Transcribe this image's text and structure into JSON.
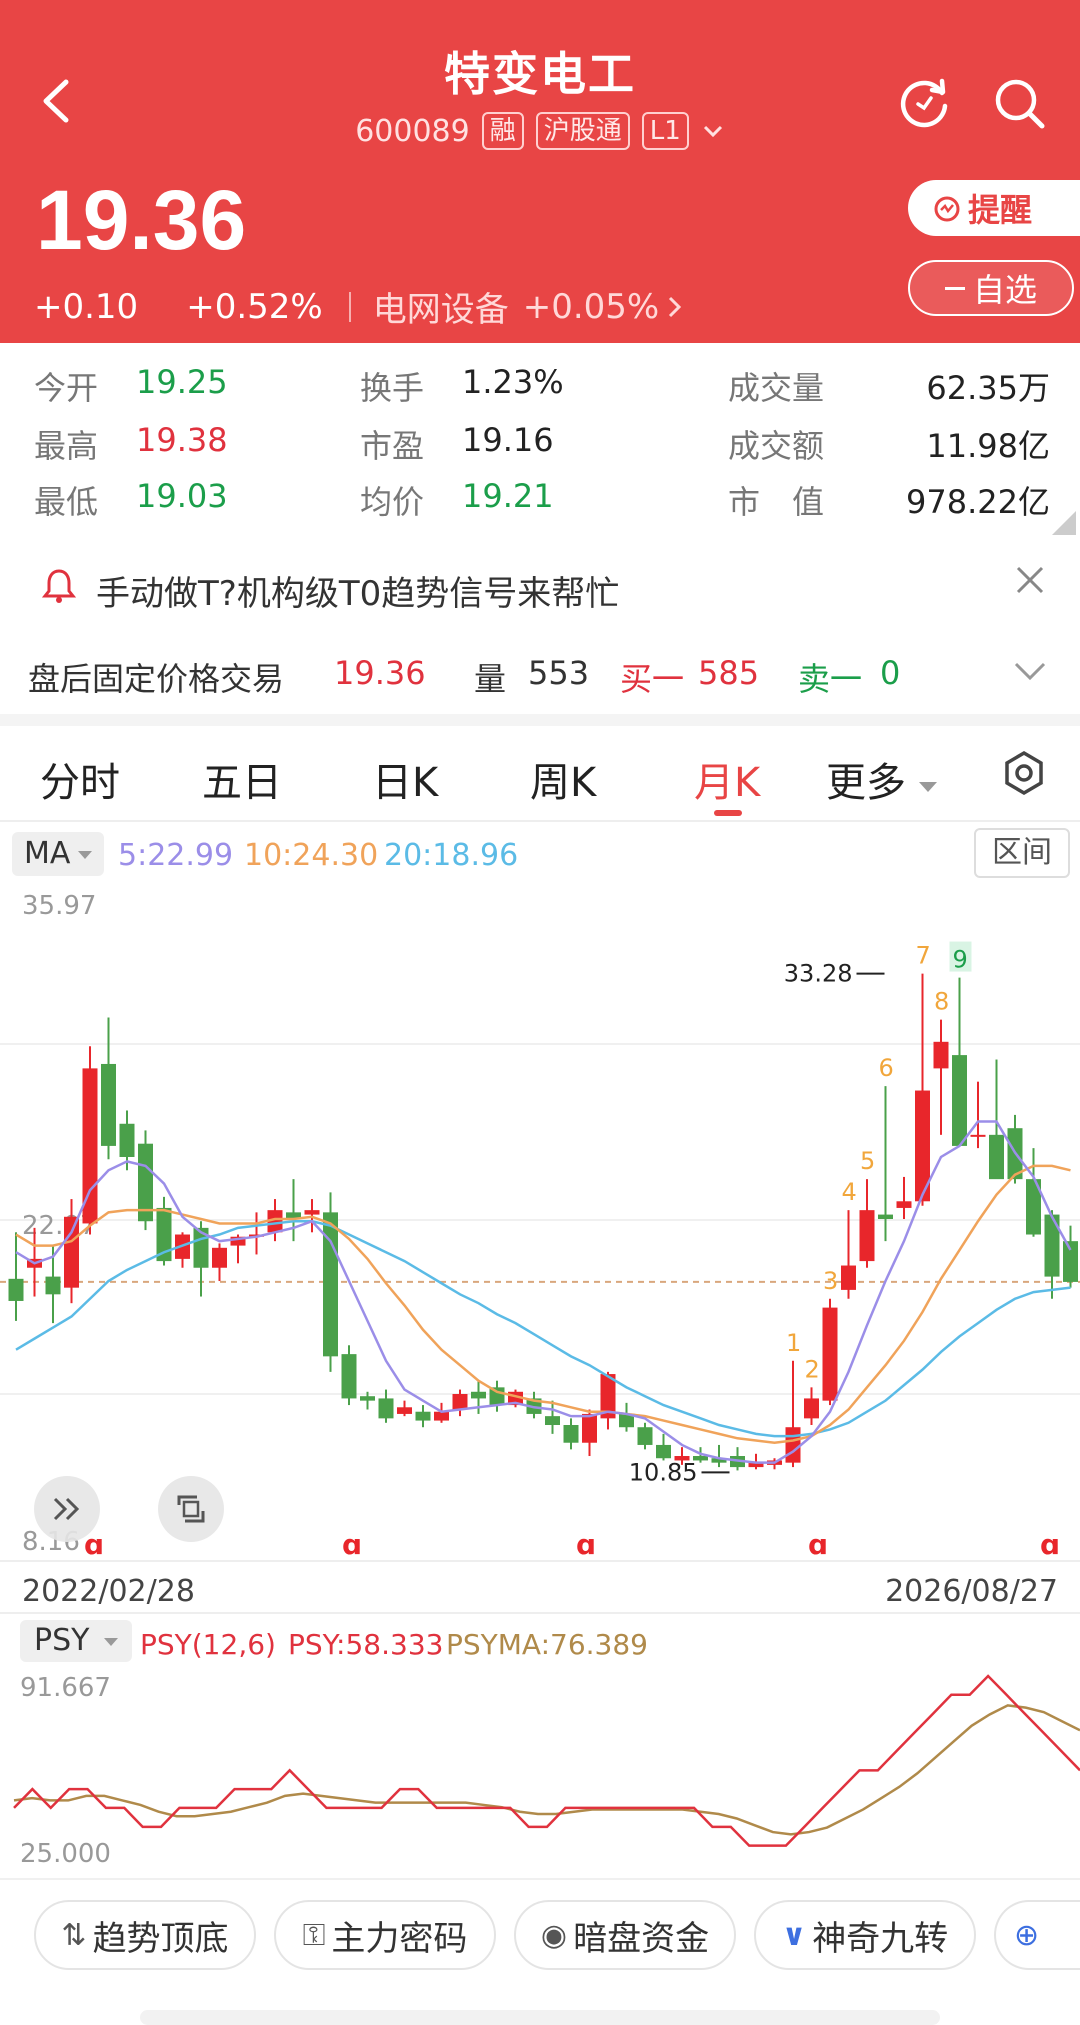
{
  "header": {
    "stock_name": "特变电工",
    "code": "600089",
    "tag_margin": "融",
    "tag_connect": "沪股通",
    "tag_level": "L1",
    "price": "19.36",
    "change": "+0.10",
    "change_pct": "+0.52%",
    "sector": "电网设备",
    "sector_pct": "+0.05%",
    "remind_label": "提醒",
    "watch_label": "自选",
    "colors": {
      "bg": "#e84545"
    }
  },
  "stats": {
    "open_label": "今开",
    "open": "19.25",
    "high_label": "最高",
    "high": "19.38",
    "low_label": "最低",
    "low": "19.03",
    "turnover_label": "换手",
    "turnover": "1.23%",
    "pe_label": "市盈",
    "pe": "19.16",
    "avg_label": "均价",
    "avg": "19.21",
    "volume_label": "成交量",
    "volume": "62.35万",
    "amount_label": "成交额",
    "amount": "11.98亿",
    "mcap_label": "市　值",
    "mcap": "978.22亿"
  },
  "promo": {
    "text": "手动做T?机构级T0趋势信号来帮忙"
  },
  "after_hours": {
    "label": "盘后固定价格交易",
    "price": "19.36",
    "vol_label": "量",
    "vol": "553",
    "bid_label": "买一",
    "bid": "585",
    "ask_label": "卖一",
    "ask": "0"
  },
  "tabs": [
    "分时",
    "五日",
    "日K",
    "周K",
    "月K",
    "更多"
  ],
  "ma": {
    "selector": "MA",
    "ma5": "5:22.99",
    "ma10": "10:24.30",
    "ma20": "20:18.96",
    "range_label": "区间",
    "colors": {
      "ma5": "#9b8ee8",
      "ma10": "#f0a35a",
      "ma20": "#5bbbe6"
    }
  },
  "chart_data": {
    "type": "candlestick",
    "y_top_label": "35.97",
    "y_bottom_label": "8.16",
    "y_mid_label": "22.07",
    "ylim": [
      8.16,
      35.97
    ],
    "current_price_line": 19.36,
    "start_date": "2022/02/28",
    "end_date": "2026/08/27",
    "high_marker": "33.28",
    "low_marker": "10.85",
    "candles": [
      {
        "o": 19.5,
        "h": 21.6,
        "l": 17.6,
        "c": 18.5
      },
      {
        "o": 20.0,
        "h": 21.8,
        "l": 18.7,
        "c": 20.4
      },
      {
        "o": 19.6,
        "h": 21.0,
        "l": 17.5,
        "c": 18.8
      },
      {
        "o": 19.1,
        "h": 23.1,
        "l": 18.4,
        "c": 22.3
      },
      {
        "o": 22.0,
        "h": 30.0,
        "l": 21.5,
        "c": 29.0
      },
      {
        "o": 29.2,
        "h": 31.3,
        "l": 24.9,
        "c": 25.5
      },
      {
        "o": 26.5,
        "h": 27.1,
        "l": 24.4,
        "c": 25.0
      },
      {
        "o": 25.6,
        "h": 26.2,
        "l": 21.7,
        "c": 22.1
      },
      {
        "o": 22.7,
        "h": 23.2,
        "l": 20.1,
        "c": 20.3
      },
      {
        "o": 20.4,
        "h": 21.6,
        "l": 20.0,
        "c": 21.5
      },
      {
        "o": 21.8,
        "h": 22.1,
        "l": 18.7,
        "c": 20.0
      },
      {
        "o": 20.0,
        "h": 21.1,
        "l": 19.4,
        "c": 20.9
      },
      {
        "o": 21.0,
        "h": 21.5,
        "l": 20.2,
        "c": 21.4
      },
      {
        "o": 21.4,
        "h": 22.5,
        "l": 20.6,
        "c": 21.5
      },
      {
        "o": 21.6,
        "h": 23.1,
        "l": 21.2,
        "c": 22.6
      },
      {
        "o": 22.5,
        "h": 24.0,
        "l": 21.2,
        "c": 22.2
      },
      {
        "o": 22.4,
        "h": 23.1,
        "l": 21.6,
        "c": 22.6
      },
      {
        "o": 22.5,
        "h": 23.4,
        "l": 15.3,
        "c": 16.0
      },
      {
        "o": 16.1,
        "h": 16.5,
        "l": 13.8,
        "c": 14.1
      },
      {
        "o": 14.2,
        "h": 14.4,
        "l": 13.6,
        "c": 14.0
      },
      {
        "o": 14.1,
        "h": 14.5,
        "l": 13.0,
        "c": 13.2
      },
      {
        "o": 13.4,
        "h": 14.0,
        "l": 13.3,
        "c": 13.7
      },
      {
        "o": 13.5,
        "h": 13.8,
        "l": 12.8,
        "c": 13.1
      },
      {
        "o": 13.1,
        "h": 13.9,
        "l": 13.0,
        "c": 13.5
      },
      {
        "o": 13.6,
        "h": 14.5,
        "l": 13.3,
        "c": 14.3
      },
      {
        "o": 14.4,
        "h": 14.9,
        "l": 13.4,
        "c": 14.1
      },
      {
        "o": 14.6,
        "h": 14.9,
        "l": 13.5,
        "c": 13.8
      },
      {
        "o": 13.8,
        "h": 14.5,
        "l": 13.7,
        "c": 14.4
      },
      {
        "o": 14.1,
        "h": 14.4,
        "l": 13.2,
        "c": 13.4
      },
      {
        "o": 13.3,
        "h": 14.0,
        "l": 12.5,
        "c": 12.9
      },
      {
        "o": 12.9,
        "h": 13.2,
        "l": 11.8,
        "c": 12.1
      },
      {
        "o": 12.1,
        "h": 13.6,
        "l": 11.5,
        "c": 13.4
      },
      {
        "o": 13.2,
        "h": 15.3,
        "l": 12.7,
        "c": 15.2
      },
      {
        "o": 13.4,
        "h": 13.9,
        "l": 12.6,
        "c": 12.8
      },
      {
        "o": 12.8,
        "h": 13.0,
        "l": 11.8,
        "c": 12.0
      },
      {
        "o": 12.0,
        "h": 12.5,
        "l": 11.3,
        "c": 11.4
      },
      {
        "o": 11.3,
        "h": 11.9,
        "l": 11.1,
        "c": 11.5
      },
      {
        "o": 11.5,
        "h": 11.9,
        "l": 11.2,
        "c": 11.3
      },
      {
        "o": 11.4,
        "h": 12.0,
        "l": 11.0,
        "c": 11.2
      },
      {
        "o": 11.5,
        "h": 11.9,
        "l": 10.85,
        "c": 11.0
      },
      {
        "o": 11.0,
        "h": 11.6,
        "l": 10.9,
        "c": 11.2
      },
      {
        "o": 11.1,
        "h": 11.4,
        "l": 10.9,
        "c": 11.3
      },
      {
        "o": 11.2,
        "h": 15.8,
        "l": 11.0,
        "c": 12.8
      },
      {
        "o": 13.2,
        "h": 14.6,
        "l": 12.9,
        "c": 14.1
      },
      {
        "o": 14.0,
        "h": 18.6,
        "l": 13.8,
        "c": 18.2
      },
      {
        "o": 19.0,
        "h": 22.6,
        "l": 18.6,
        "c": 20.1
      },
      {
        "o": 20.3,
        "h": 24.0,
        "l": 20.0,
        "c": 22.6
      },
      {
        "o": 22.4,
        "h": 28.2,
        "l": 21.2,
        "c": 22.2
      },
      {
        "o": 22.7,
        "h": 24.1,
        "l": 22.2,
        "c": 23.0
      },
      {
        "o": 23.0,
        "h": 33.28,
        "l": 22.8,
        "c": 28.0
      },
      {
        "o": 29.0,
        "h": 31.2,
        "l": 26.0,
        "c": 30.2
      },
      {
        "o": 29.6,
        "h": 33.1,
        "l": 25.8,
        "c": 25.5
      },
      {
        "o": 26.0,
        "h": 28.4,
        "l": 25.4,
        "c": 26.0
      },
      {
        "o": 26.0,
        "h": 29.4,
        "l": 25.5,
        "c": 24.0
      },
      {
        "o": 26.3,
        "h": 26.9,
        "l": 23.8,
        "c": 24.0
      },
      {
        "o": 24.0,
        "h": 25.4,
        "l": 21.4,
        "c": 21.5
      },
      {
        "o": 22.4,
        "h": 22.6,
        "l": 18.6,
        "c": 19.6
      },
      {
        "o": 21.2,
        "h": 21.9,
        "l": 19.1,
        "c": 19.36
      }
    ],
    "ma5_curve": [
      20.7,
      20.2,
      20.5,
      21.6,
      23.5,
      24.4,
      24.8,
      24.6,
      23.8,
      22.3,
      21.6,
      21.2,
      21.3,
      21.4,
      21.6,
      21.8,
      22.1,
      21.2,
      19.4,
      17.6,
      15.8,
      14.5,
      14.0,
      13.5,
      13.6,
      13.7,
      13.8,
      13.9,
      13.7,
      13.6,
      13.3,
      13.3,
      13.5,
      13.4,
      13.2,
      12.6,
      12.0,
      11.6,
      11.4,
      11.3,
      11.2,
      11.2,
      11.7,
      12.4,
      13.5,
      15.3,
      17.4,
      19.4,
      21.2,
      23.3,
      25.0,
      25.5,
      26.6,
      26.6,
      25.2,
      24.1,
      22.3,
      20.8
    ],
    "ma10_curve": [
      21.5,
      21.0,
      21.0,
      21.2,
      21.9,
      22.5,
      22.6,
      22.6,
      22.6,
      22.4,
      22.2,
      22.0,
      22.0,
      22.0,
      22.2,
      22.2,
      22.3,
      22.0,
      21.3,
      20.4,
      19.3,
      18.3,
      17.2,
      16.3,
      15.6,
      14.9,
      14.4,
      14.2,
      14.0,
      13.9,
      13.7,
      13.5,
      13.5,
      13.4,
      13.3,
      13.1,
      12.9,
      12.7,
      12.5,
      12.3,
      12.2,
      12.1,
      12.2,
      12.4,
      12.9,
      13.6,
      14.6,
      15.6,
      16.7,
      18.0,
      19.5,
      20.8,
      22.1,
      23.3,
      24.2,
      24.6,
      24.6,
      24.4
    ],
    "ma20_curve": [
      16.3,
      16.8,
      17.3,
      17.8,
      18.6,
      19.4,
      19.9,
      20.3,
      20.7,
      21.0,
      21.3,
      21.5,
      21.8,
      21.9,
      22.0,
      22.1,
      22.1,
      21.9,
      21.5,
      21.1,
      20.7,
      20.3,
      19.8,
      19.3,
      18.8,
      18.4,
      17.9,
      17.5,
      17.0,
      16.5,
      16.0,
      15.6,
      15.1,
      14.6,
      14.2,
      13.8,
      13.5,
      13.2,
      12.9,
      12.7,
      12.5,
      12.4,
      12.4,
      12.5,
      12.7,
      13.0,
      13.5,
      14.0,
      14.7,
      15.4,
      16.2,
      16.9,
      17.5,
      18.1,
      18.6,
      18.9,
      19.0,
      19.1
    ],
    "nine_turn": [
      {
        "i": 42,
        "label": "1"
      },
      {
        "i": 43,
        "label": "2"
      },
      {
        "i": 44,
        "label": "3"
      },
      {
        "i": 45,
        "label": "4"
      },
      {
        "i": 46,
        "label": "5"
      },
      {
        "i": 47,
        "label": "6"
      },
      {
        "i": 49,
        "label": "7"
      },
      {
        "i": 50,
        "label": "8"
      },
      {
        "i": 51,
        "label": "9"
      }
    ]
  },
  "psy": {
    "selector": "PSY",
    "params": "PSY(12,6)",
    "psy_val": "PSY:58.333",
    "psyma_val": "PSYMA:76.389",
    "top_label": "91.667",
    "bottom_label": "25.000",
    "colors": {
      "psy": "#e0323e",
      "psyma": "#b08a4a"
    },
    "ylim": [
      16,
      100
    ],
    "psy_series": [
      41.7,
      50,
      41.7,
      50,
      50,
      41.7,
      41.7,
      33.3,
      33.3,
      41.7,
      41.7,
      41.7,
      50,
      50,
      50,
      58.3,
      50,
      41.7,
      41.7,
      41.7,
      41.7,
      50,
      50,
      41.7,
      41.7,
      41.7,
      41.7,
      41.7,
      33.3,
      33.3,
      41.7,
      41.7,
      41.7,
      41.7,
      41.7,
      41.7,
      41.7,
      41.7,
      33.3,
      33.3,
      25,
      25,
      25,
      33.3,
      41.7,
      50,
      58.3,
      58.3,
      66.7,
      75,
      83.3,
      91.7,
      91.7,
      100,
      91.7,
      83.3,
      75,
      66.7,
      58.3
    ],
    "psyma_series": [
      45,
      46,
      45,
      45,
      47,
      47,
      45,
      43,
      40,
      38,
      38,
      39,
      40,
      42,
      44,
      47,
      48,
      47,
      46,
      45,
      44,
      44,
      44,
      44,
      44,
      44,
      43,
      42,
      40,
      39,
      39,
      40,
      41,
      41,
      41,
      41,
      41,
      41,
      40,
      39,
      37,
      34,
      31,
      30,
      31,
      33,
      37,
      41,
      46,
      51,
      57,
      64,
      71,
      78,
      83,
      87,
      86,
      84,
      80,
      76
    ]
  },
  "bottom_bar": {
    "trend_label": "趋势顶底",
    "fund_label": "主力密码",
    "dark_label": "暗盘资金",
    "nine_label": "神奇九转"
  }
}
